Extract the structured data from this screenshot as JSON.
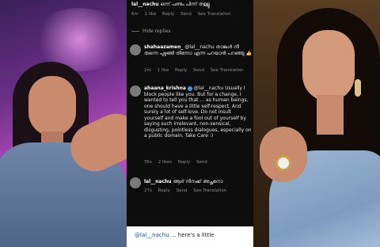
{
  "top_comment": {
    "username": "lal__nachu",
    "text": "ഒന്ന് പണ്ടം പിന്ന് തള്ളൂ",
    "meta": [
      "6m",
      "1 like",
      "Reply",
      "Send",
      "See Translation"
    ]
  },
  "hide_replies_label": "Hide replies",
  "replies": [
    {
      "username": "shahaazamen_",
      "mention": "@lal__nachu",
      "text": "താങ്കൾ നീ തന്നെ പുഴുങ്ങി തിന്നോ എന്ന പറയാൻ പറഞ്ഞു 👍",
      "meta": [
        "2m",
        "1 like",
        "Reply",
        "Send",
        "See Translation"
      ]
    },
    {
      "username": "ahaana_krishna",
      "verified": true,
      "mention": "@lal__nachu",
      "text": "Usually I block people like you. But for a change, I wanted to tell you that ... as human beings, one should have a little self-respect. And surely a lot of self-love. Do not insult yourself and make a fool out of yourself by saying such irrelevant, non-sensical, disgusting, pointless dialogues, especially on a public domain. Take Care :)",
      "meta": [
        "36s",
        "2 likes",
        "Reply",
        "Send"
      ]
    },
    {
      "username": "lal__nachu",
      "text": "ആര് നിനക്ക് അച്ഛനോ",
      "meta": [
        "27s",
        "Reply",
        "Send",
        "See Translation"
      ]
    }
  ],
  "caption": {
    "mention": "@lal__nachu",
    "text": " ... here's a little"
  }
}
